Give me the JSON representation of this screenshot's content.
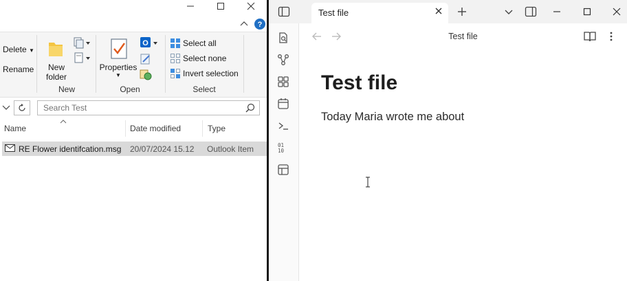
{
  "explorer": {
    "ribbon": {
      "organize": {
        "delete_label": "Delete",
        "rename_label": "Rename"
      },
      "new": {
        "new_folder_line1": "New",
        "new_folder_line2": "folder",
        "group_label": "New"
      },
      "open": {
        "properties_label": "Properties",
        "group_label": "Open"
      },
      "select": {
        "select_all": "Select all",
        "select_none": "Select none",
        "invert_selection": "Invert selection",
        "group_label": "Select"
      }
    },
    "search": {
      "placeholder": "Search Test"
    },
    "columns": {
      "name": "Name",
      "date_modified": "Date modified",
      "type": "Type"
    },
    "files": [
      {
        "name": "RE Flower identifcation.msg",
        "date": "20/07/2024 15.12",
        "type": "Outlook Item"
      }
    ],
    "colors": {
      "help_blue": "#1f6fc4",
      "selected_row": "#d9d9d9"
    }
  },
  "obsidian": {
    "tab": {
      "title": "Test file"
    },
    "nav": {
      "title": "Test file"
    },
    "note": {
      "heading": "Test file",
      "body": "Today Maria wrote me about"
    }
  }
}
